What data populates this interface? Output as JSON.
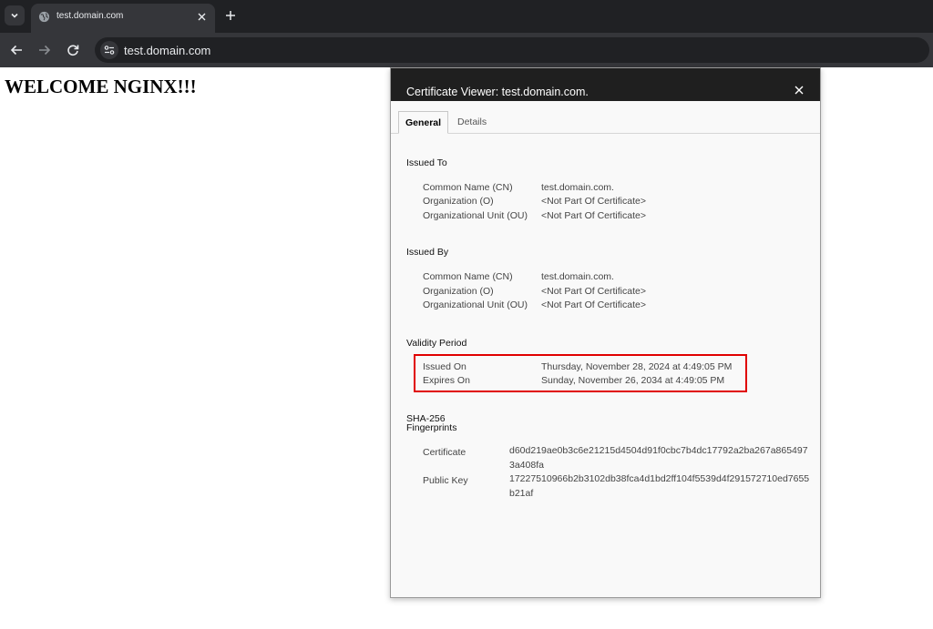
{
  "browser": {
    "tab": {
      "title": "test.domain.com"
    },
    "address_bar": {
      "url": "test.domain.com"
    },
    "colors": {
      "frame": "#202124",
      "toolbar": "#35363a",
      "text": "#e8eaed"
    }
  },
  "page": {
    "heading": "WELCOME NGINX!!!"
  },
  "dialog": {
    "title": "Certificate Viewer: test.domain.com.",
    "tabs": [
      {
        "label": "General",
        "selected": true
      },
      {
        "label": "Details",
        "selected": false
      }
    ],
    "issued_to": {
      "title": "Issued To",
      "rows": [
        {
          "label": "Common Name (CN)",
          "value": "test.domain.com."
        },
        {
          "label": "Organization (O)",
          "value": "<Not Part Of Certificate>"
        },
        {
          "label": "Organizational Unit (OU)",
          "value": "<Not Part Of Certificate>"
        }
      ]
    },
    "issued_by": {
      "title": "Issued By",
      "rows": [
        {
          "label": "Common Name (CN)",
          "value": "test.domain.com."
        },
        {
          "label": "Organization (O)",
          "value": "<Not Part Of Certificate>"
        },
        {
          "label": "Organizational Unit (OU)",
          "value": "<Not Part Of Certificate>"
        }
      ]
    },
    "validity": {
      "title": "Validity Period",
      "rows": [
        {
          "label": "Issued On",
          "value": "Thursday, November 28, 2024 at 4:49:05 PM"
        },
        {
          "label": "Expires On",
          "value": "Sunday, November 26, 2034 at 4:49:05 PM"
        }
      ],
      "highlight_color": "#e00000"
    },
    "fingerprints": {
      "title_line1": "SHA-256",
      "title_line2": "Fingerprints",
      "rows": [
        {
          "label": "Certificate",
          "value": "d60d219ae0b3c6e21215d4504d91f0cbc7b4dc17792a2ba267a8654973a408fa"
        },
        {
          "label": "Public Key",
          "value": "17227510966b2b3102db38fca4d1bd2ff104f5539d4f291572710ed7655b21af"
        }
      ]
    }
  }
}
